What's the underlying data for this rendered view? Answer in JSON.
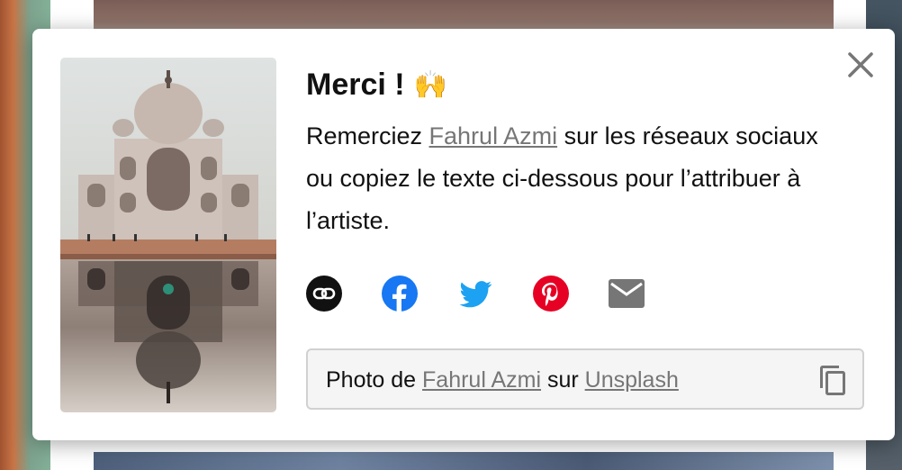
{
  "modal": {
    "title": "Merci !",
    "title_emoji": "🙌",
    "description_prefix": "Remerciez ",
    "photographer": "Fahrul Azmi",
    "description_suffix": " sur les réseaux sociaux ou copiez le texte ci-dessous pour l’attribuer à l’artiste.",
    "share_icons": [
      "link-icon",
      "facebook-icon",
      "twitter-icon",
      "pinterest-icon",
      "email-icon"
    ],
    "attribution": {
      "prefix": "Photo de ",
      "photographer": "Fahrul Azmi",
      "middle": " sur ",
      "site": "Unsplash"
    },
    "colors": {
      "facebook": "#1877f2",
      "twitter": "#1da1f2",
      "pinterest": "#e60023",
      "link_bg": "#111111",
      "email": "#767676"
    }
  }
}
